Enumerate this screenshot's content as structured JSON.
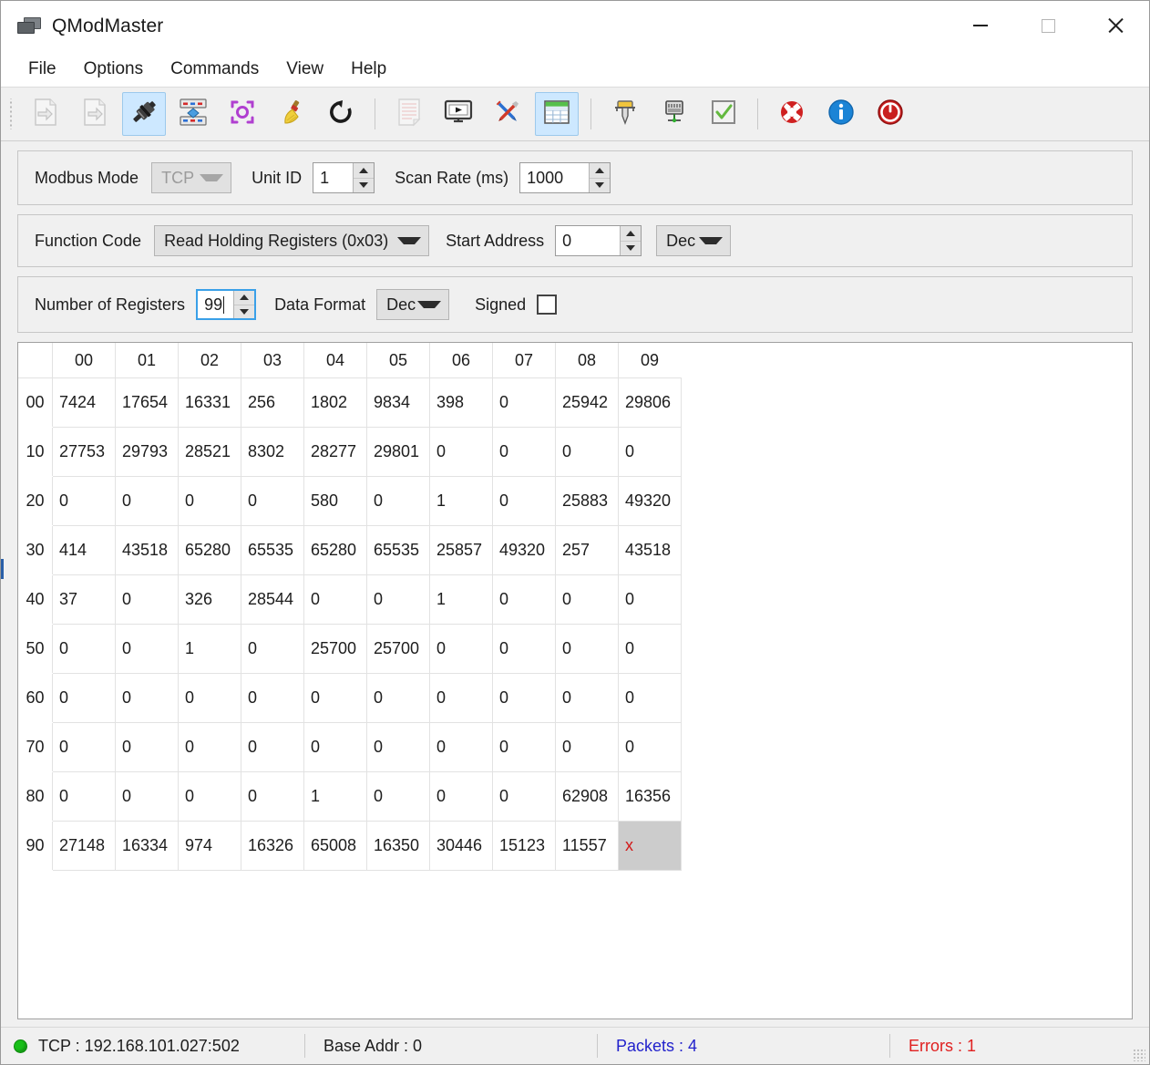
{
  "window": {
    "title": "QModMaster",
    "controls": {
      "minimize": "minimize",
      "maximize": "maximize",
      "close": "close"
    }
  },
  "menu": {
    "items": [
      {
        "label": "File"
      },
      {
        "label": "Options"
      },
      {
        "label": "Commands"
      },
      {
        "label": "View"
      },
      {
        "label": "Help"
      }
    ]
  },
  "toolbar": {
    "buttons": [
      {
        "icon": "open-file-icon",
        "active": false,
        "disabled": true
      },
      {
        "icon": "save-file-icon",
        "active": false,
        "disabled": true
      },
      {
        "icon": "connect-plug-icon",
        "active": true,
        "disabled": false
      },
      {
        "icon": "modbus-settings-icon",
        "active": false,
        "disabled": false
      },
      {
        "icon": "scan-refresh-icon",
        "active": false,
        "disabled": false
      },
      {
        "icon": "clear-broom-icon",
        "active": false,
        "disabled": false
      },
      {
        "icon": "reset-counters-icon",
        "active": false,
        "disabled": false
      },
      {
        "separator": true
      },
      {
        "icon": "log-document-icon",
        "active": false,
        "disabled": true
      },
      {
        "icon": "bus-monitor-icon",
        "active": false,
        "disabled": false
      },
      {
        "icon": "tools-icon",
        "active": false,
        "disabled": false
      },
      {
        "icon": "data-table-icon",
        "active": true,
        "disabled": false
      },
      {
        "separator": true
      },
      {
        "icon": "modbus-master-icon",
        "active": false,
        "disabled": false
      },
      {
        "icon": "modbus-slave-icon",
        "active": false,
        "disabled": false
      },
      {
        "icon": "checkbox-check-icon",
        "active": false,
        "disabled": false
      },
      {
        "separator": true
      },
      {
        "icon": "help-lifering-icon",
        "active": false,
        "disabled": false
      },
      {
        "icon": "about-info-icon",
        "active": false,
        "disabled": false
      },
      {
        "icon": "quit-power-icon",
        "active": false,
        "disabled": false
      }
    ]
  },
  "connection": {
    "modbus_mode_label": "Modbus Mode",
    "modbus_mode_value": "TCP",
    "unit_id_label": "Unit ID",
    "unit_id_value": "1",
    "scan_rate_label": "Scan Rate (ms)",
    "scan_rate_value": "1000"
  },
  "request": {
    "function_code_label": "Function Code",
    "function_code_value": "Read Holding Registers (0x03)",
    "start_address_label": "Start Address",
    "start_address_value": "0",
    "address_format_value": "Dec"
  },
  "display": {
    "num_registers_label": "Number of Registers",
    "num_registers_value": "99",
    "data_format_label": "Data Format",
    "data_format_value": "Dec",
    "signed_label": "Signed",
    "signed_checked": false
  },
  "table": {
    "column_headers": [
      "00",
      "01",
      "02",
      "03",
      "04",
      "05",
      "06",
      "07",
      "08",
      "09"
    ],
    "row_headers": [
      "00",
      "10",
      "20",
      "30",
      "40",
      "50",
      "60",
      "70",
      "80",
      "90"
    ],
    "rows": [
      [
        "7424",
        "17654",
        "16331",
        "256",
        "1802",
        "9834",
        "398",
        "0",
        "25942",
        "29806"
      ],
      [
        "27753",
        "29793",
        "28521",
        "8302",
        "28277",
        "29801",
        "0",
        "0",
        "0",
        "0"
      ],
      [
        "0",
        "0",
        "0",
        "0",
        "580",
        "0",
        "1",
        "0",
        "25883",
        "49320"
      ],
      [
        "414",
        "43518",
        "65280",
        "65535",
        "65280",
        "65535",
        "25857",
        "49320",
        "257",
        "43518"
      ],
      [
        "37",
        "0",
        "326",
        "28544",
        "0",
        "0",
        "1",
        "0",
        "0",
        "0"
      ],
      [
        "0",
        "0",
        "1",
        "0",
        "25700",
        "25700",
        "0",
        "0",
        "0",
        "0"
      ],
      [
        "0",
        "0",
        "0",
        "0",
        "0",
        "0",
        "0",
        "0",
        "0",
        "0"
      ],
      [
        "0",
        "0",
        "0",
        "0",
        "0",
        "0",
        "0",
        "0",
        "0",
        "0"
      ],
      [
        "0",
        "0",
        "0",
        "0",
        "1",
        "0",
        "0",
        "0",
        "62908",
        "16356"
      ],
      [
        "27148",
        "16334",
        "974",
        "16326",
        "65008",
        "16350",
        "30446",
        "15123",
        "11557",
        "x"
      ]
    ],
    "selected_cell": {
      "row": 9,
      "col": 9
    }
  },
  "status": {
    "connection": "TCP : 192.168.101.027:502",
    "base_addr": "Base Addr : 0",
    "packets": "Packets : 4",
    "errors": "Errors : 1",
    "led_color": "#19bf19",
    "packets_color": "#2222cc",
    "errors_color": "#e02020"
  }
}
